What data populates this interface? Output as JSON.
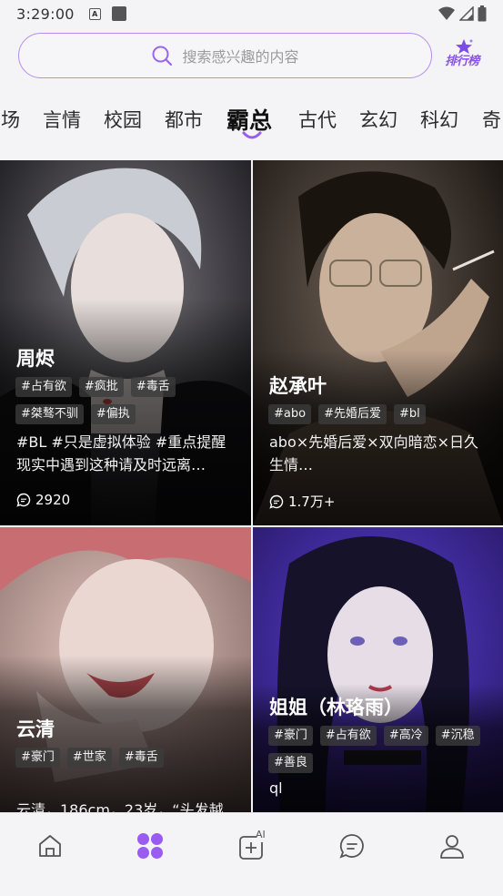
{
  "status_bar": {
    "time": "3:29:00",
    "notification_letter": "A"
  },
  "search": {
    "placeholder": "搜索感兴趣的内容"
  },
  "rank_badge": {
    "label": "排行榜"
  },
  "categories": [
    {
      "label": "场",
      "active": false
    },
    {
      "label": "言情",
      "active": false
    },
    {
      "label": "校园",
      "active": false
    },
    {
      "label": "都市",
      "active": false
    },
    {
      "label": "霸总",
      "active": true
    },
    {
      "label": "古代",
      "active": false
    },
    {
      "label": "玄幻",
      "active": false
    },
    {
      "label": "科幻",
      "active": false
    },
    {
      "label": "奇",
      "active": false
    }
  ],
  "cards": [
    {
      "name": "周烬",
      "tags": [
        "#占有欲",
        "#疯批",
        "#毒舌",
        "#桀骜不驯",
        "#偏执"
      ],
      "description": "#BL  #只是虚拟体验  #重点提醒现实中遇到这种请及时远离…",
      "count": "2920"
    },
    {
      "name": "赵承叶",
      "tags": [
        "#abo",
        "#先婚后爱",
        "#bl"
      ],
      "description": "abo×先婚后爱×双向暗恋×日久生情…",
      "count": "1.7万+"
    },
    {
      "name": "云清",
      "tags": [
        "#豪门",
        "#世家",
        "#毒舌"
      ],
      "description": "云清，186cm，23岁，“头发越"
    },
    {
      "name": "姐姐（林珞雨）",
      "tags": [
        "#豪门",
        "#占有欲",
        "#高冷",
        "#沉稳",
        "#善良"
      ],
      "description": "ql"
    }
  ],
  "bottom_nav": [
    {
      "icon": "home-icon",
      "active": false
    },
    {
      "icon": "discover-grid-icon",
      "active": true
    },
    {
      "icon": "ai-create-icon",
      "active": false,
      "badge": "AI"
    },
    {
      "icon": "chat-icon",
      "active": false
    },
    {
      "icon": "profile-icon",
      "active": false
    }
  ],
  "colors": {
    "accent": "#9a5cf0",
    "text": "#2b2b2b",
    "card_overlay": "#000000"
  }
}
